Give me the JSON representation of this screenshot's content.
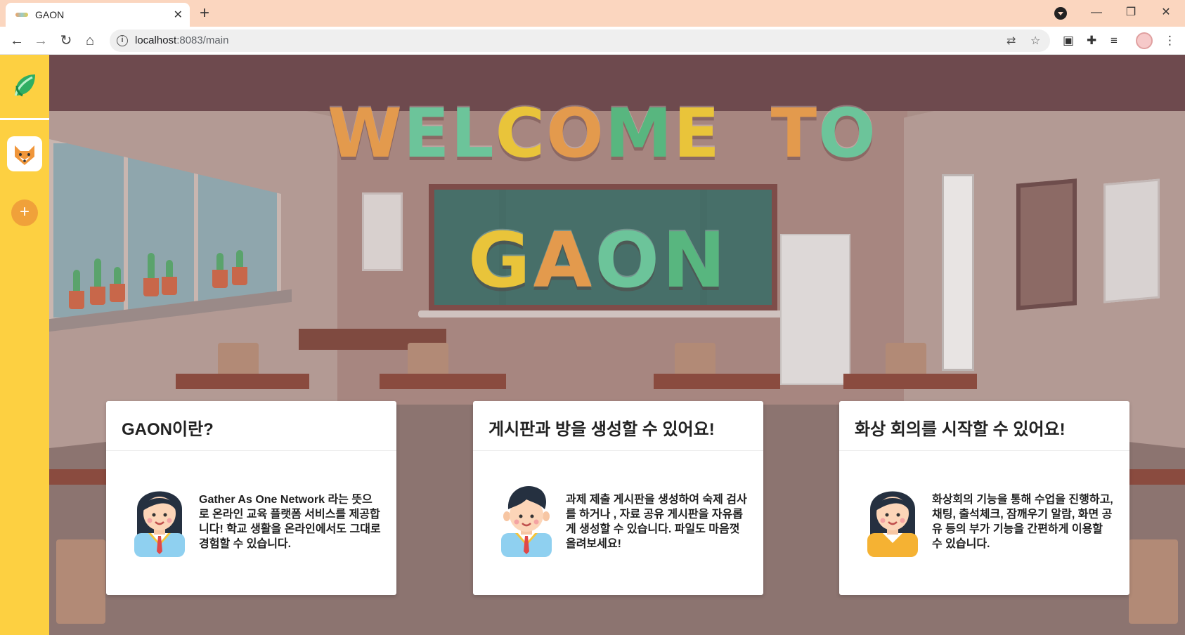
{
  "browser": {
    "tab_title": "GAON",
    "url_host": "localhost",
    "url_rest": ":8083/main"
  },
  "icons": {
    "logo": "leaf-icon",
    "room": "fox-icon",
    "add": "plus-icon"
  },
  "hero": {
    "line1": [
      "W",
      "E",
      "L",
      "C",
      "O",
      "M",
      "E",
      " ",
      "T",
      "O"
    ],
    "line1_colors": [
      "#e39a4d",
      "#6cc49a",
      "#6cc49a",
      "#e9c43a",
      "#e39a4d",
      "#58b67f",
      "#e9c43a",
      "",
      "#e39a4d",
      "#6cc49a"
    ],
    "line2": [
      "G",
      "A",
      "O",
      "N"
    ],
    "line2_colors": [
      "#e9c43a",
      "#e39a4d",
      "#6cc49a",
      "#58b67f"
    ]
  },
  "cards": [
    {
      "title": "GAON이란?",
      "text": "Gather As One Network 라는 뜻으로 온라인 교육 플랫폼 서비스를 제공합니다! 학교 생활을 온라인에서도 그대로 경험할 수 있습니다.",
      "avatar": "girl-student-avatar"
    },
    {
      "title": "게시판과 방을 생성할 수 있어요!",
      "text": "과제 제출 게시판을 생성하여 숙제 검사를 하거나 , 자료 공유 게시판을 자유롭게 생성할 수 있습니다. 파일도 마음껏 올려보세요!",
      "avatar": "boy-student-avatar"
    },
    {
      "title": "화상 회의를 시작할 수 있어요!",
      "text": "화상회의 기능을 통해 수업을 진행하고, 채팅, 출석체크, 잠깨우기 알람, 화면 공유 등의 부가 기능을 간편하게 이용할 수 있습니다.",
      "avatar": "girl-teacher-avatar"
    }
  ]
}
